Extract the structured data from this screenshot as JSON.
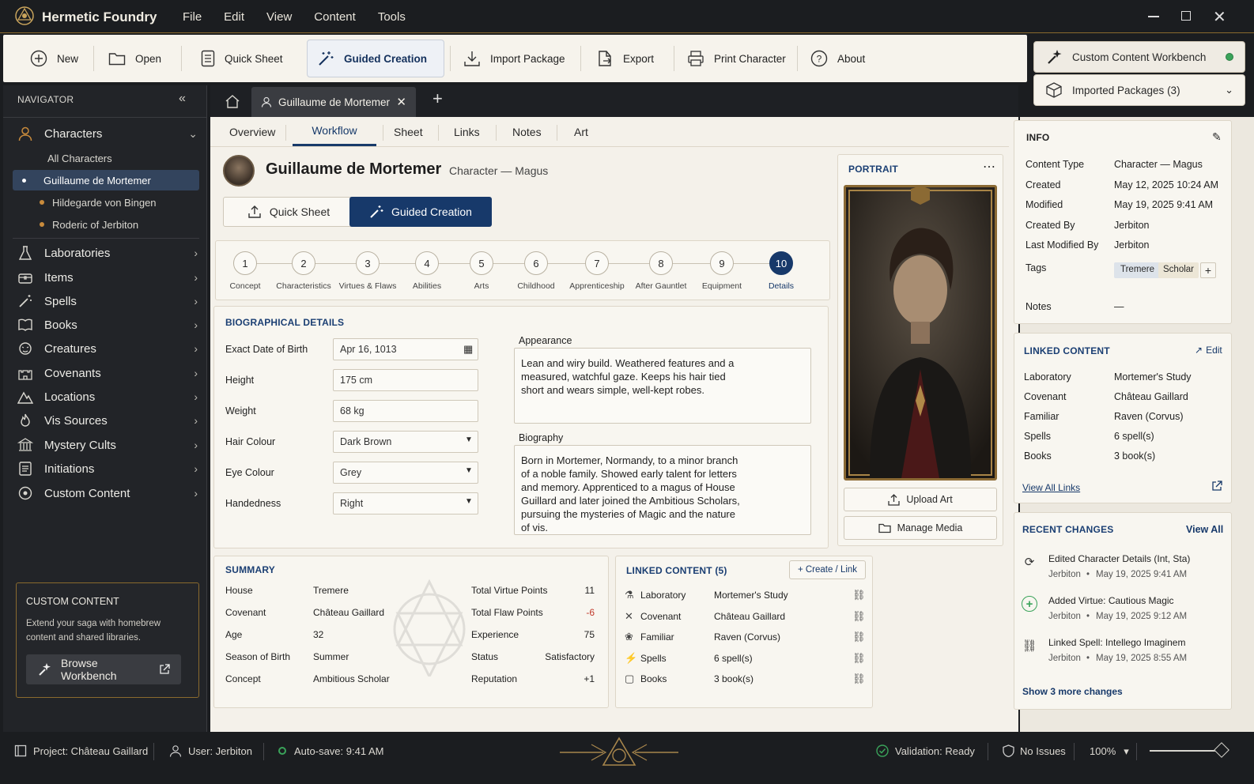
{
  "app": {
    "title": "Hermetic Foundry",
    "menu": [
      "File",
      "Edit",
      "View",
      "Content",
      "Tools"
    ]
  },
  "toolbar": {
    "new": "New",
    "open": "Open",
    "quick_sheet": "Quick Sheet",
    "guided": "Guided Creation",
    "import": "Import Package",
    "export": "Export",
    "print": "Print Character",
    "about": "About"
  },
  "workbench": {
    "label": "Custom Content Workbench",
    "status_color": "#3aa35a",
    "imported": "Imported Packages (3)"
  },
  "navigator": {
    "title": "NAVIGATOR",
    "characters": "Characters",
    "all_characters": "All Characters",
    "chars": [
      "Guillaume de Mortemer",
      "Hildegarde von Bingen",
      "Roderic of Jerbiton"
    ],
    "items": [
      "Laboratories",
      "Items",
      "Spells",
      "Books",
      "Creatures",
      "Covenants",
      "Locations",
      "Vis Sources",
      "Mystery Cults",
      "Initiations",
      "Custom Content"
    ]
  },
  "custom_box": {
    "title": "CUSTOM CONTENT",
    "text": "Extend your saga with homebrew content and shared libraries.",
    "button": "Browse Workbench"
  },
  "doc_tab": {
    "label": "Guillaume de Mortemer"
  },
  "subtabs": [
    "Overview",
    "Workflow",
    "Sheet",
    "Links",
    "Notes",
    "Art"
  ],
  "character": {
    "name": "Guillaume de Mortemer",
    "type": "Character — Magus"
  },
  "mode": {
    "quick": "Quick Sheet",
    "guided": "Guided Creation"
  },
  "steps": [
    {
      "n": "1",
      "t": "Concept"
    },
    {
      "n": "2",
      "t": "Characteristics"
    },
    {
      "n": "3",
      "t": "Virtues & Flaws"
    },
    {
      "n": "4",
      "t": "Abilities"
    },
    {
      "n": "5",
      "t": "Arts"
    },
    {
      "n": "6",
      "t": "Childhood"
    },
    {
      "n": "7",
      "t": "Apprenticeship"
    },
    {
      "n": "8",
      "t": "After Gauntlet"
    },
    {
      "n": "9",
      "t": "Equipment"
    },
    {
      "n": "10",
      "t": "Details"
    }
  ],
  "bio": {
    "title": "BIOGRAPHICAL DETAILS",
    "fields": [
      {
        "label": "Exact Date of Birth",
        "value": "Apr 16, 1013"
      },
      {
        "label": "Height",
        "value": "175 cm"
      },
      {
        "label": "Weight",
        "value": "68 kg"
      },
      {
        "label": "Hair Colour",
        "value": "Dark Brown"
      },
      {
        "label": "Eye Colour",
        "value": "Grey"
      },
      {
        "label": "Handedness",
        "value": "Right"
      }
    ],
    "appearance_label": "Appearance",
    "appearance": "Lean and wiry build. Weathered features and a\nmeasured, watchful gaze. Keeps his hair tied\nshort and wears simple, well-kept robes.",
    "biography_label": "Biography",
    "biography": "Born in Mortemer, Normandy, to a minor branch\nof a noble family. Showed early talent for letters\nand memory. Apprenticed to a magus of House\nGuillard and later joined the Ambitious Scholars,\npursuing the mysteries of Magic and the nature\nof vis."
  },
  "portrait": {
    "title": "PORTRAIT",
    "upload": "Upload Art",
    "manage": "Manage Media"
  },
  "summary": {
    "title": "SUMMARY",
    "left": [
      {
        "k": "House",
        "v": "Tremere"
      },
      {
        "k": "Covenant",
        "v": "Château Gaillard"
      },
      {
        "k": "Age",
        "v": "32"
      },
      {
        "k": "Season of Birth",
        "v": "Summer"
      },
      {
        "k": "Concept",
        "v": "Ambitious Scholar"
      }
    ],
    "right": [
      {
        "k": "Total Virtue Points",
        "v": "11"
      },
      {
        "k": "Total Flaw Points",
        "v": "-6"
      },
      {
        "k": "Experience",
        "v": "75"
      },
      {
        "k": "Status",
        "v": "Satisfactory"
      },
      {
        "k": "Reputation",
        "v": "+1"
      }
    ]
  },
  "linked": {
    "title": "LINKED CONTENT (5)",
    "create": "+ Create / Link",
    "rows": [
      {
        "k": "Laboratory",
        "v": "Mortemer's Study"
      },
      {
        "k": "Covenant",
        "v": "Château Gaillard"
      },
      {
        "k": "Familiar",
        "v": "Raven (Corvus)"
      },
      {
        "k": "Spells",
        "v": "6 spell(s)"
      },
      {
        "k": "Books",
        "v": "3 book(s)"
      }
    ]
  },
  "info": {
    "title": "INFO",
    "rows": [
      {
        "k": "Content Type",
        "v": "Character — Magus"
      },
      {
        "k": "Created",
        "v": "May 12, 2025 10:24 AM"
      },
      {
        "k": "Modified",
        "v": "May 19, 2025 9:41 AM"
      },
      {
        "k": "Created By",
        "v": "Jerbiton"
      },
      {
        "k": "Last Modified By",
        "v": "Jerbiton"
      }
    ],
    "tags_label": "Tags",
    "tags": [
      "Tremere",
      "Scholar"
    ],
    "notes_label": "Notes",
    "notes": "—"
  },
  "rlinked": {
    "title": "LINKED CONTENT",
    "edit": "Edit",
    "rows": [
      {
        "k": "Laboratory",
        "v": "Mortemer's Study"
      },
      {
        "k": "Covenant",
        "v": "Château Gaillard"
      },
      {
        "k": "Familiar",
        "v": "Raven (Corvus)"
      },
      {
        "k": "Spells",
        "v": "6 spell(s)"
      },
      {
        "k": "Books",
        "v": "3 book(s)"
      }
    ],
    "view_all": "View All Links"
  },
  "changes": {
    "title": "RECENT CHANGES",
    "view_all": "View All",
    "items": [
      {
        "t": "Edited Character Details (Int, Sta)",
        "by": "Jerbiton",
        "when": "May 19, 2025 9:41 AM"
      },
      {
        "t": "Added Virtue: Cautious Magic",
        "by": "Jerbiton",
        "when": "May 19, 2025 9:12 AM"
      },
      {
        "t": "Linked Spell: Intellego Imaginem",
        "by": "Jerbiton",
        "when": "May 19, 2025 8:55 AM"
      }
    ],
    "more": "Show 3 more changes"
  },
  "status": {
    "project": "Project: Château Gaillard",
    "user": "User: Jerbiton",
    "autosave": "Auto-save: 9:41 AM",
    "validation": "Validation: Ready",
    "issues": "No Issues",
    "zoom": "100%"
  }
}
